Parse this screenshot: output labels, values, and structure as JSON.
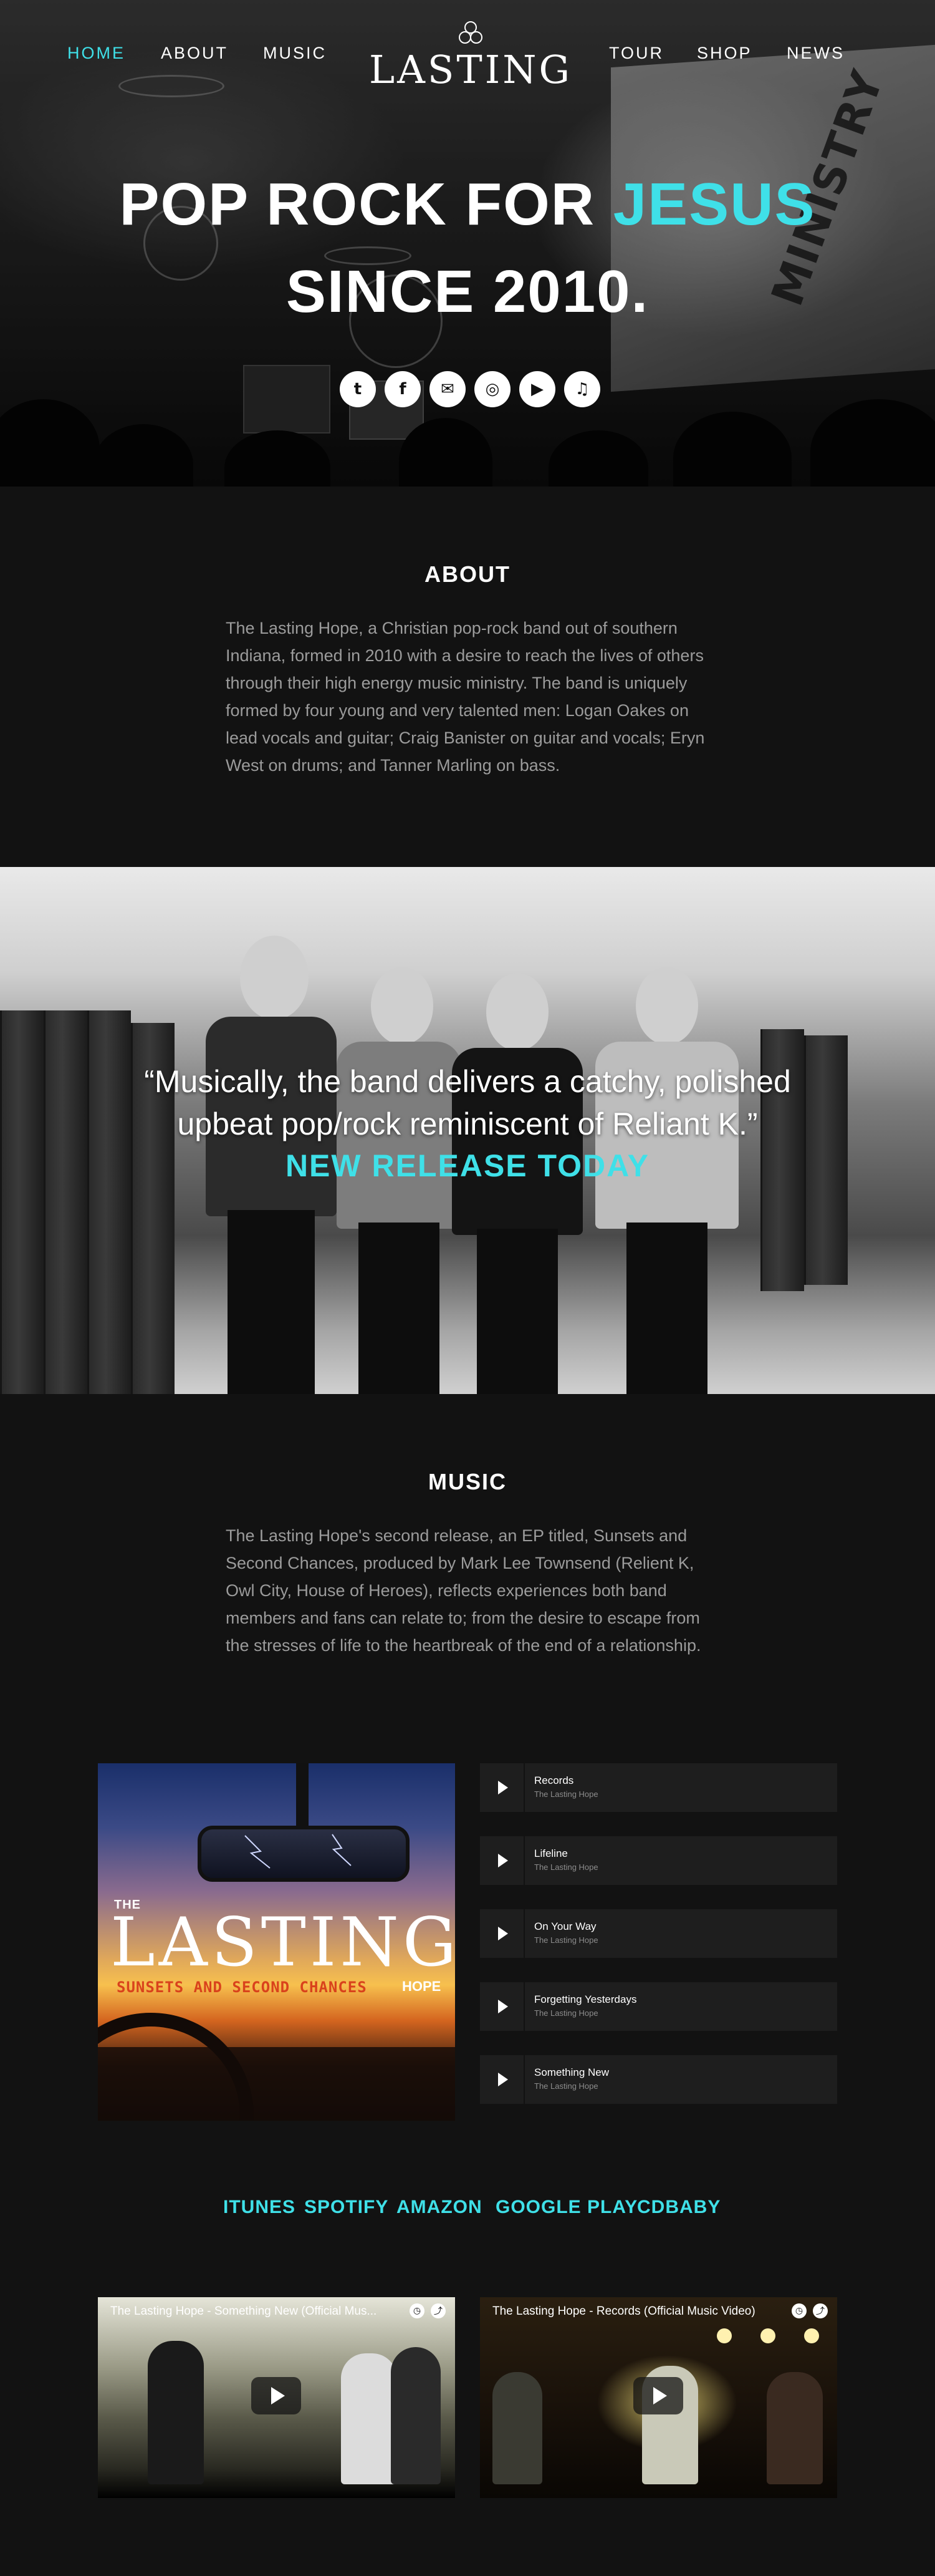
{
  "nav": {
    "items": [
      {
        "label": "HOME",
        "active": true
      },
      {
        "label": "ABOUT",
        "active": false
      },
      {
        "label": "MUSIC",
        "active": false
      },
      {
        "label": "TOUR",
        "active": false
      },
      {
        "label": "SHOP",
        "active": false
      },
      {
        "label": "NEWS",
        "active": false
      }
    ],
    "logo_text": "LASTING",
    "logo_icon": "knot-logo-icon"
  },
  "hero": {
    "title_line1": "POP ROCK FOR ",
    "title_accent": "JESUS",
    "title_line2": "SINCE 2010.",
    "socials": [
      {
        "icon": "twitter-icon",
        "glyph": "t"
      },
      {
        "icon": "facebook-icon",
        "glyph": "f"
      },
      {
        "icon": "email-icon",
        "glyph": "✉"
      },
      {
        "icon": "instagram-icon",
        "glyph": "◎"
      },
      {
        "icon": "youtube-icon",
        "glyph": "▶"
      },
      {
        "icon": "music-note-icon",
        "glyph": "♫"
      }
    ]
  },
  "about": {
    "title": "ABOUT",
    "text": "The Lasting Hope, a Christian pop-rock band out of southern Indiana, formed in 2010 with a desire to reach the lives of others through their high energy music ministry. The band is uniquely formed by four young and very talented men: Logan Oakes on lead vocals and guitar; Craig Banister on guitar and vocals; Eryn West on drums; and Tanner Marling on bass."
  },
  "quote": {
    "line1": "“Musically, the band delivers a catchy, polished",
    "line2": "upbeat pop/rock reminiscent of Reliant K.”",
    "cta": "NEW RELEASE TODAY"
  },
  "music": {
    "title": "MUSIC",
    "text": "The Lasting Hope's second release, an EP titled, Sunsets and Second Chances, produced by Mark Lee Townsend (Relient K, Owl City, House of Heroes), reflects experiences both band members and fans can relate to; from the desire to escape from the stresses of life to the heartbreak of the end of a relationship.",
    "album": {
      "the": "THE",
      "lasting": "LASTING",
      "subtitle": "SUNSETS AND SECOND CHANCES",
      "hope": "HOPE"
    },
    "tracks": [
      {
        "name": "Records",
        "artist": "The Lasting Hope"
      },
      {
        "name": "Lifeline",
        "artist": "The Lasting Hope"
      },
      {
        "name": "On Your Way",
        "artist": "The Lasting Hope"
      },
      {
        "name": "Forgetting Yesterdays",
        "artist": "The Lasting Hope"
      },
      {
        "name": "Something New",
        "artist": "The Lasting Hope"
      }
    ],
    "stores": [
      "ITUNES",
      "SPOTIFY",
      "AMAZON",
      "GOOGLE PLAY",
      "CDBABY"
    ]
  },
  "videos": [
    {
      "title": "The Lasting Hope - Something New (Official Mus..."
    },
    {
      "title": "The Lasting Hope - Records (Official Music Video)"
    }
  ],
  "colors": {
    "accent": "#3fe0e8",
    "background": "#121212",
    "track_bg": "#1e1e1e",
    "body_text": "#9b9b9b"
  }
}
